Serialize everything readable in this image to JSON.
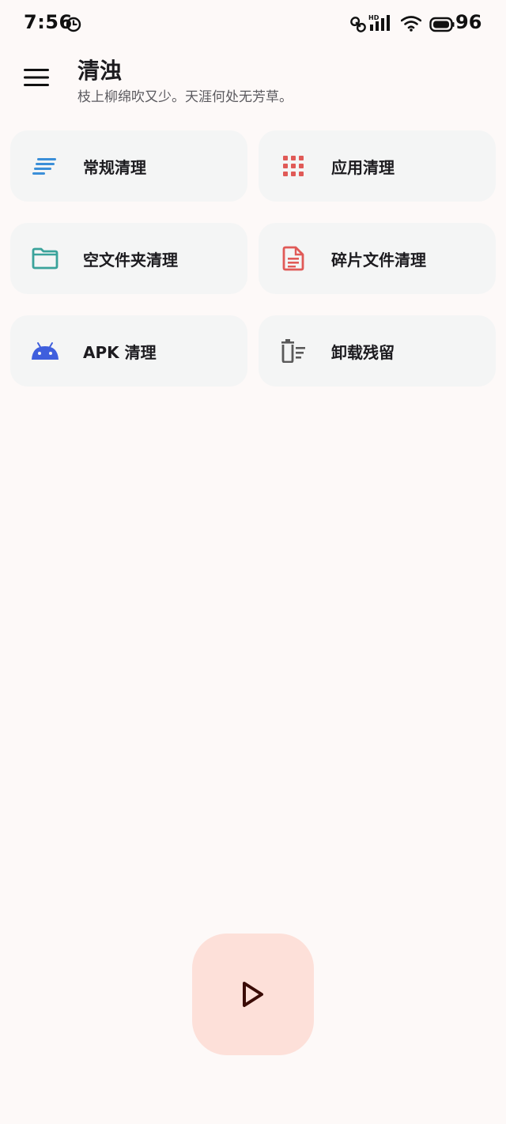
{
  "status_bar": {
    "time": "7:56",
    "battery_level": "96",
    "icons": [
      "clock-icon",
      "link-icon",
      "hd-signal-icon",
      "wifi-icon",
      "battery-icon"
    ]
  },
  "header": {
    "title": "清浊",
    "subtitle": "枝上柳绵吹又少。天涯何处无芳草。"
  },
  "cards": [
    {
      "label": "常规清理",
      "icon": "general-clean-icon",
      "color": "#3b8fd8"
    },
    {
      "label": "应用清理",
      "icon": "apps-grid-icon",
      "color": "#e05a57"
    },
    {
      "label": "空文件夹清理",
      "icon": "folder-icon",
      "color": "#3aa39b"
    },
    {
      "label": "碎片文件清理",
      "icon": "document-icon",
      "color": "#e05a57"
    },
    {
      "label": "APK 清理",
      "icon": "android-icon",
      "color": "#3f5fdd"
    },
    {
      "label": "卸载残留",
      "icon": "trash-list-icon",
      "color": "#5a5a5a"
    }
  ],
  "fab": {
    "icon": "play-icon",
    "background": "#fde0d9",
    "icon_color": "#3a0b06"
  }
}
